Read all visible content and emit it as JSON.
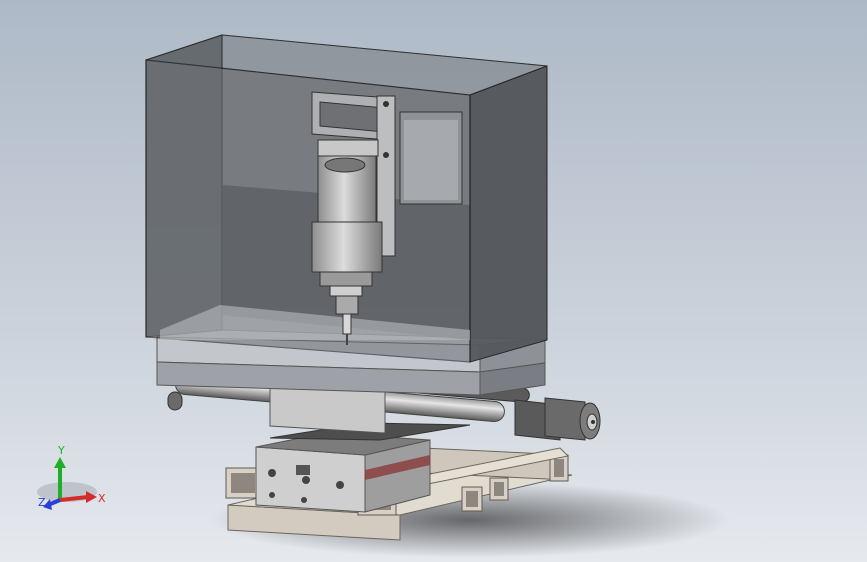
{
  "triad": {
    "x_label": "X",
    "y_label": "Y",
    "z_label": "Z",
    "x_color": "#d42a2a",
    "y_color": "#1fae2a",
    "z_color": "#2a3fd4"
  },
  "colors": {
    "background_top": "#b8c2cf",
    "background_bottom": "#e4e8ee",
    "enclosure_glass": "#6a6f74",
    "metal": "#b9b9b9",
    "frame": "#d2cabe"
  }
}
